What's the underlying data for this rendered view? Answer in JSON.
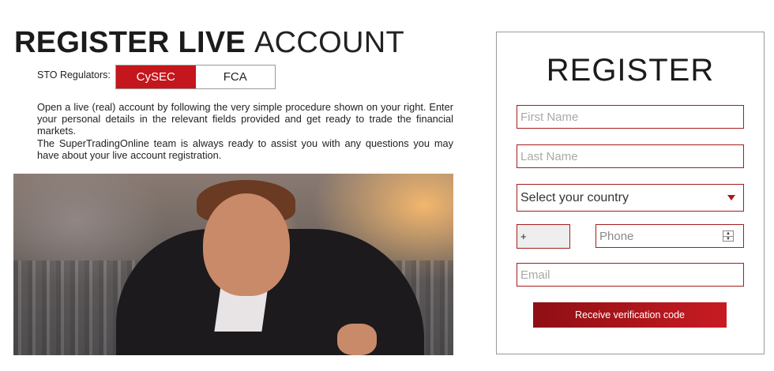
{
  "page": {
    "title_bold": "REGISTER LIVE",
    "title_light": "ACCOUNT"
  },
  "regulators": {
    "label": "STO Regulators:",
    "tabs": [
      {
        "label": "CySEC",
        "active": true
      },
      {
        "label": "FCA",
        "active": false
      }
    ],
    "active_color": "#c4161c"
  },
  "intro": {
    "paragraph_1": "Open a live (real) account by following the very simple procedure shown on your right. Enter your personal details in the relevant fields provided and get ready to trade the financial markets.",
    "paragraph_2": "The SuperTradingOnline team is always ready to assist you with any questions you may have about your live account registration."
  },
  "form": {
    "title": "REGISTER",
    "first_name_placeholder": "First Name",
    "last_name_placeholder": "Last Name",
    "country_selected": "Select your country",
    "phone_prefix": "+",
    "phone_placeholder": "Phone",
    "email_placeholder": "Email",
    "submit_label": "Receive verification code",
    "border_color": "#a31d1d",
    "button_color": "#c81b22"
  },
  "icons": {
    "country_dropdown": "caret-down-icon",
    "phone_spinner": "spinner-icon"
  }
}
